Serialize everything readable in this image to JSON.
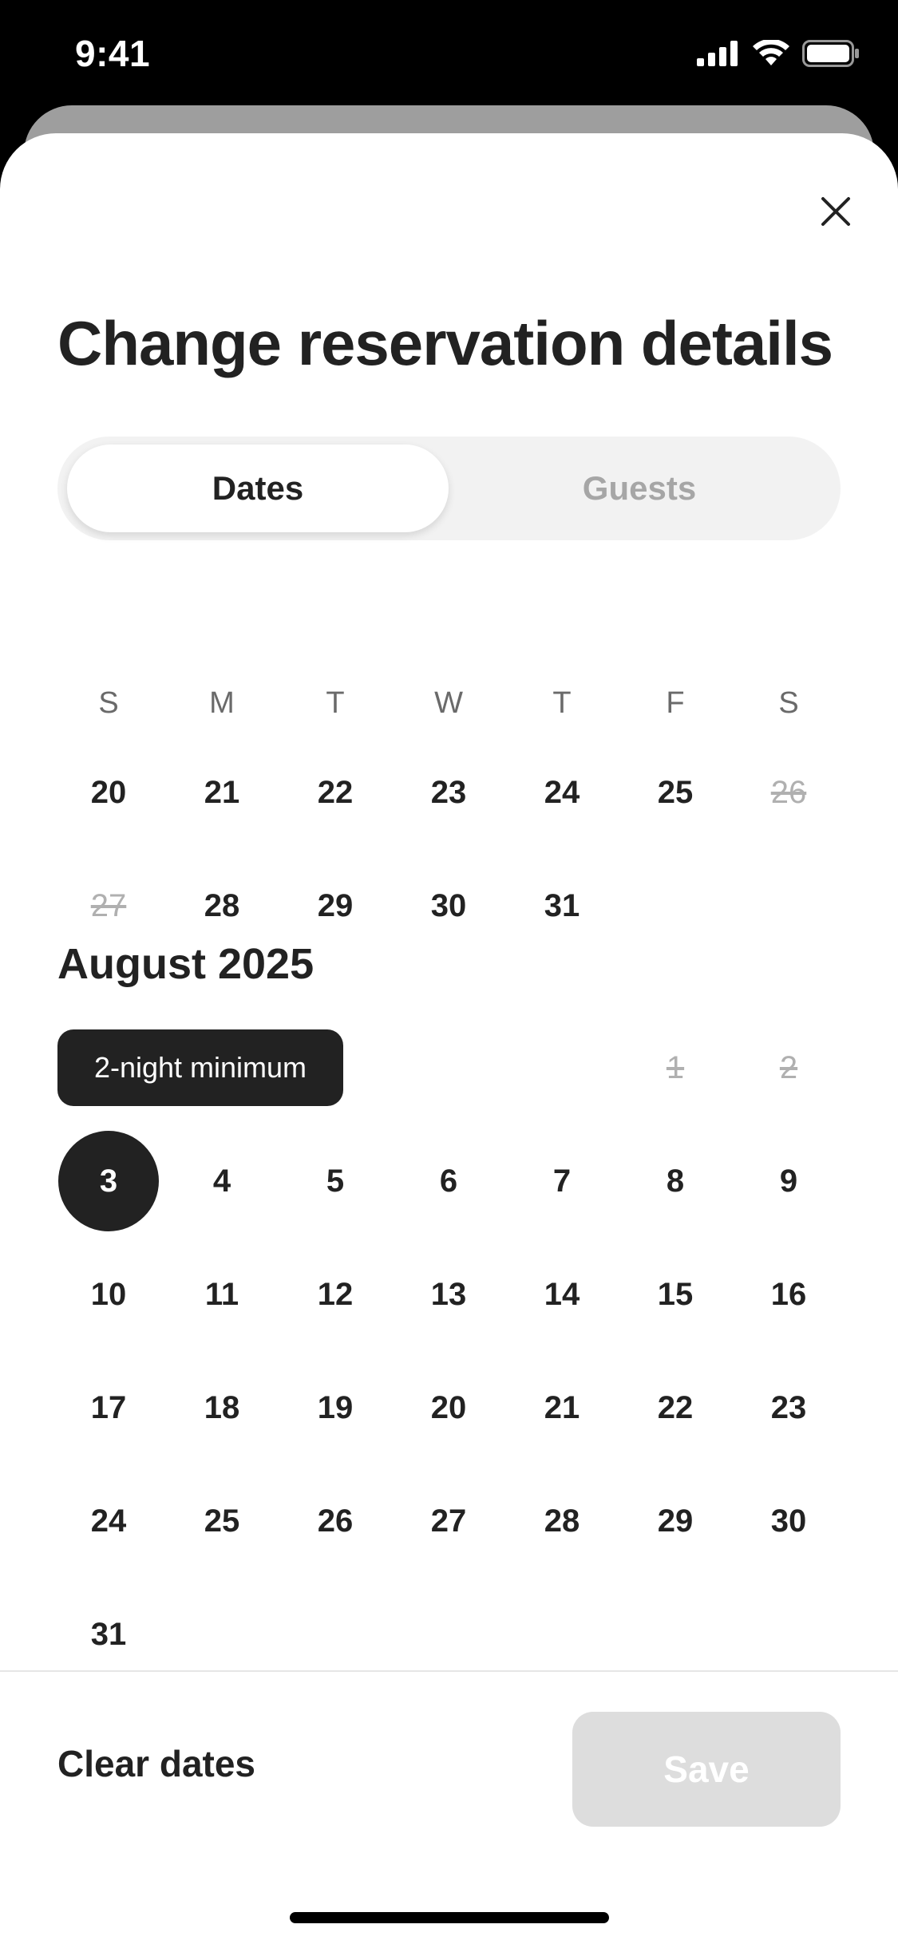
{
  "status_bar": {
    "time": "9:41",
    "icons": [
      "signal-icon",
      "wifi-icon",
      "battery-icon"
    ]
  },
  "sheet": {
    "title": "Change reservation details",
    "close_icon": "close-icon",
    "tabs": [
      {
        "label": "Dates",
        "active": true
      },
      {
        "label": "Guests",
        "active": false
      }
    ]
  },
  "calendar": {
    "weekdays": [
      "S",
      "M",
      "T",
      "W",
      "T",
      "F",
      "S"
    ],
    "july_rows": [
      [
        "20",
        "21",
        "22",
        "23",
        "24",
        "25",
        "26"
      ],
      [
        "27",
        "28",
        "29",
        "30",
        "31",
        "",
        ""
      ]
    ],
    "july_unavailable": [
      [
        false,
        false,
        false,
        false,
        false,
        false,
        true
      ],
      [
        true,
        false,
        false,
        false,
        false,
        false,
        false
      ]
    ],
    "august": {
      "title": "August 2025",
      "tooltip": "2-night minimum",
      "rows": [
        [
          "",
          "",
          "",
          "",
          "",
          "1",
          "2"
        ],
        [
          "3",
          "4",
          "5",
          "6",
          "7",
          "8",
          "9"
        ],
        [
          "10",
          "11",
          "12",
          "13",
          "14",
          "15",
          "16"
        ],
        [
          "17",
          "18",
          "19",
          "20",
          "21",
          "22",
          "23"
        ],
        [
          "24",
          "25",
          "26",
          "27",
          "28",
          "29",
          "30"
        ],
        [
          "31",
          "",
          "",
          "",
          "",
          "",
          ""
        ]
      ],
      "unavailable": [
        "1",
        "2"
      ],
      "selected": "3"
    }
  },
  "footer": {
    "clear_label": "Clear dates",
    "save_label": "Save",
    "save_enabled": false
  },
  "colors": {
    "primary_text": "#222222",
    "muted": "#b0b0b0",
    "disabled_button": "#dddddd"
  }
}
